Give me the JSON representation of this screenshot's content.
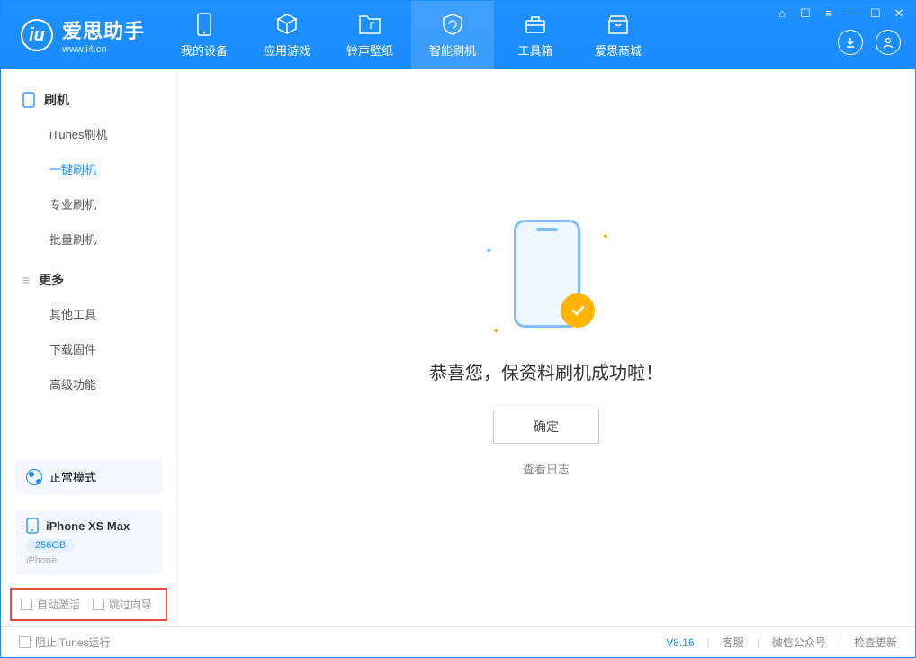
{
  "app": {
    "name": "爱思助手",
    "url": "www.i4.cn",
    "logo_letter": "iu"
  },
  "nav": {
    "items": [
      {
        "label": "我的设备"
      },
      {
        "label": "应用游戏"
      },
      {
        "label": "铃声壁纸"
      },
      {
        "label": "智能刷机"
      },
      {
        "label": "工具箱"
      },
      {
        "label": "爱思商城"
      }
    ],
    "active_index": 3
  },
  "sidebar": {
    "groups": [
      {
        "header": "刷机",
        "items": [
          "iTunes刷机",
          "一键刷机",
          "专业刷机",
          "批量刷机"
        ],
        "active_index": 1
      },
      {
        "header": "更多",
        "items": [
          "其他工具",
          "下载固件",
          "高级功能"
        ],
        "active_index": -1
      }
    ],
    "mode": {
      "label": "正常模式"
    },
    "device": {
      "name": "iPhone XS Max",
      "capacity": "256GB",
      "type": "iPhone"
    },
    "options": {
      "auto_activate": "自动激活",
      "skip_guide": "跳过向导"
    }
  },
  "main": {
    "success_text": "恭喜您，保资料刷机成功啦！",
    "ok_button": "确定",
    "view_log": "查看日志"
  },
  "status": {
    "block_itunes": "阻止iTunes运行",
    "version": "V8.16",
    "links": [
      "客服",
      "微信公众号",
      "检查更新"
    ]
  }
}
